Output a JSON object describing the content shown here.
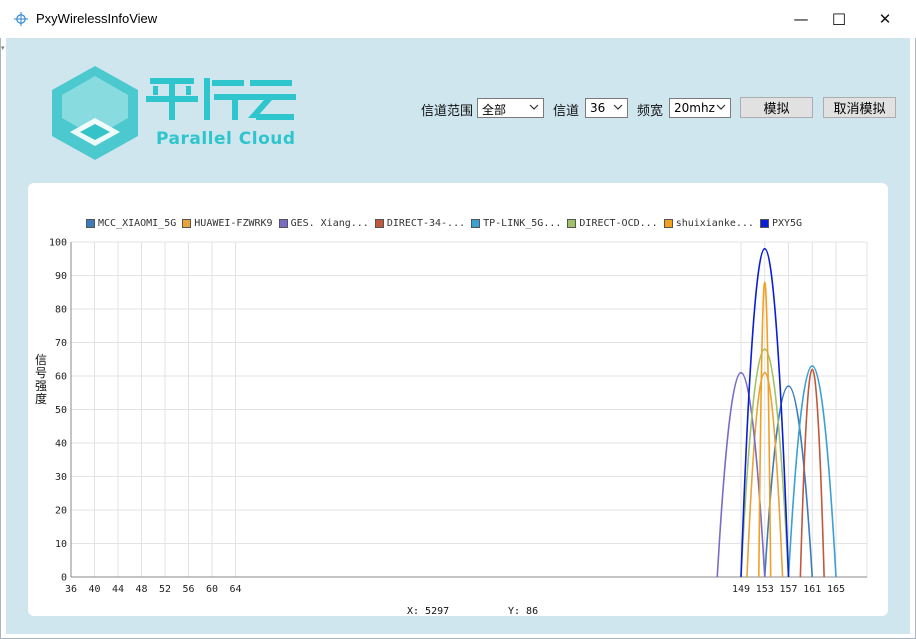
{
  "window": {
    "title": "PxyWirelessInfoView",
    "min_glyph": "—",
    "max_glyph": "☐",
    "close_glyph": "✕"
  },
  "logo": {
    "text": "Parallel Cloud",
    "brand_color": "#2fc5cc"
  },
  "controls": {
    "range_label": "信道范围",
    "range_value": "全部",
    "channel_label": "信道",
    "channel_value": "36",
    "bandwidth_label": "频宽",
    "bandwidth_value": "20mhz",
    "simulate_label": "模拟",
    "cancel_simulate_label": "取消模拟"
  },
  "chart_data": {
    "type": "line",
    "ylabel": "信号强度",
    "ylim": [
      0,
      100
    ],
    "yticks": [
      0,
      10,
      20,
      30,
      40,
      50,
      60,
      70,
      80,
      90,
      100
    ],
    "channel_ticks_low": [
      36,
      40,
      44,
      48,
      52,
      56,
      60,
      64
    ],
    "channel_ticks_high": [
      149,
      153,
      157,
      161,
      165
    ],
    "grid": true,
    "legend_position": "top",
    "series": [
      {
        "name": "MCC_XIAOMI_5G",
        "color": "#3c7bbf",
        "center": 157,
        "peak": 57,
        "halfwidth": 4
      },
      {
        "name": "HUAWEI-FZWRK9",
        "color": "#e8a33a",
        "center": 153,
        "peak": 61,
        "halfwidth": 3
      },
      {
        "name": "GES. Xiang...",
        "color": "#7a6cc6",
        "center": 149,
        "peak": 61,
        "halfwidth": 4
      },
      {
        "name": "DIRECT-34-...",
        "color": "#c0583c",
        "center": 161,
        "peak": 62,
        "halfwidth": 2
      },
      {
        "name": "TP-LINK_5G...",
        "color": "#3aa0d4",
        "center": 161,
        "peak": 63,
        "halfwidth": 4
      },
      {
        "name": "DIRECT-OCD...",
        "color": "#9fc266",
        "center": 153,
        "peak": 68,
        "halfwidth": 4
      },
      {
        "name": "shuixianke...",
        "color": "#f3a020",
        "center": 153,
        "peak": 88,
        "halfwidth": 1
      },
      {
        "name": "PXY5G",
        "color": "#0a1ed6",
        "center": 153,
        "peak": 98,
        "halfwidth": 4
      }
    ]
  },
  "readout": {
    "x_label": "X: 5297",
    "y_label": "Y: 86"
  }
}
